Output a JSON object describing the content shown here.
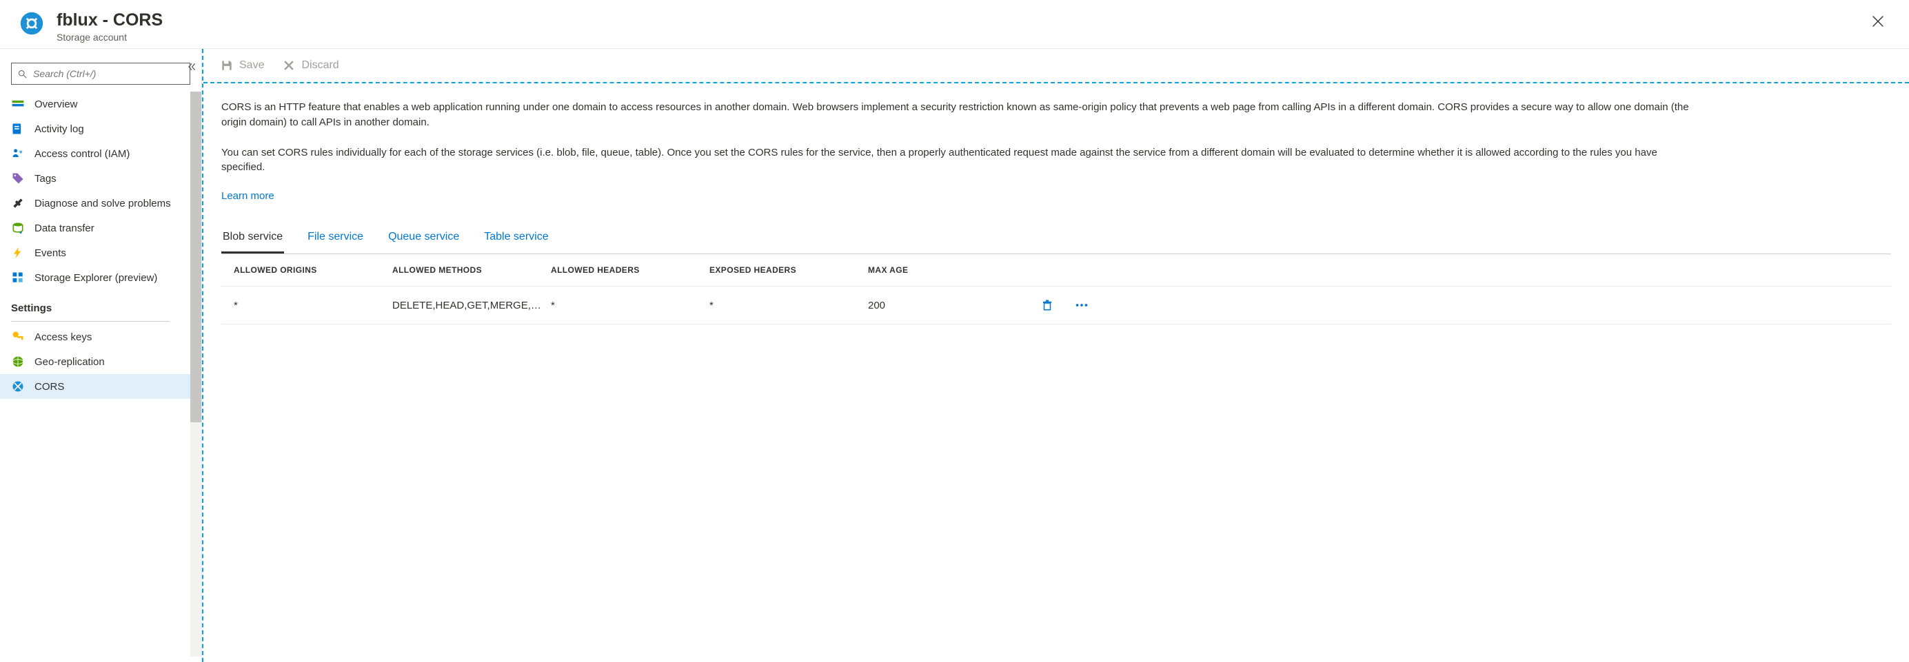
{
  "header": {
    "title": "fblux - CORS",
    "subtitle": "Storage account"
  },
  "search": {
    "placeholder": "Search (Ctrl+/)"
  },
  "sidebar": {
    "items": [
      {
        "label": "Overview",
        "icon": "overview-icon"
      },
      {
        "label": "Activity log",
        "icon": "activity-log-icon"
      },
      {
        "label": "Access control (IAM)",
        "icon": "iam-icon"
      },
      {
        "label": "Tags",
        "icon": "tags-icon"
      },
      {
        "label": "Diagnose and solve problems",
        "icon": "diagnose-icon"
      },
      {
        "label": "Data transfer",
        "icon": "data-transfer-icon"
      },
      {
        "label": "Events",
        "icon": "events-icon"
      },
      {
        "label": "Storage Explorer (preview)",
        "icon": "storage-explorer-icon"
      }
    ],
    "settingsHeader": "Settings",
    "settingsItems": [
      {
        "label": "Access keys",
        "icon": "access-keys-icon"
      },
      {
        "label": "Geo-replication",
        "icon": "geo-replication-icon"
      },
      {
        "label": "CORS",
        "icon": "cors-icon",
        "active": true
      }
    ]
  },
  "toolbar": {
    "save_label": "Save",
    "discard_label": "Discard"
  },
  "description": {
    "p1": "CORS is an HTTP feature that enables a web application running under one domain to access resources in another domain. Web browsers implement a security restriction known as same-origin policy that prevents a web page from calling APIs in a different domain. CORS provides a secure way to allow one domain (the origin domain) to call APIs in another domain.",
    "p2": "You can set CORS rules individually for each of the storage services (i.e. blob, file, queue, table). Once you set the CORS rules for the service, then a properly authenticated request made against the service from a different domain will be evaluated to determine whether it is allowed according to the rules you have specified.",
    "learn_more": "Learn more"
  },
  "tabs": [
    {
      "label": "Blob service",
      "active": true
    },
    {
      "label": "File service",
      "active": false
    },
    {
      "label": "Queue service",
      "active": false
    },
    {
      "label": "Table service",
      "active": false
    }
  ],
  "cors_table": {
    "headers": {
      "origins": "ALLOWED ORIGINS",
      "methods": "ALLOWED METHODS",
      "headers": "ALLOWED HEADERS",
      "exposed": "EXPOSED HEADERS",
      "maxage": "MAX AGE"
    },
    "rows": [
      {
        "origins": "*",
        "methods": "DELETE,HEAD,GET,MERGE,PO…",
        "headers": "*",
        "exposed": "*",
        "maxage": "200"
      }
    ]
  }
}
